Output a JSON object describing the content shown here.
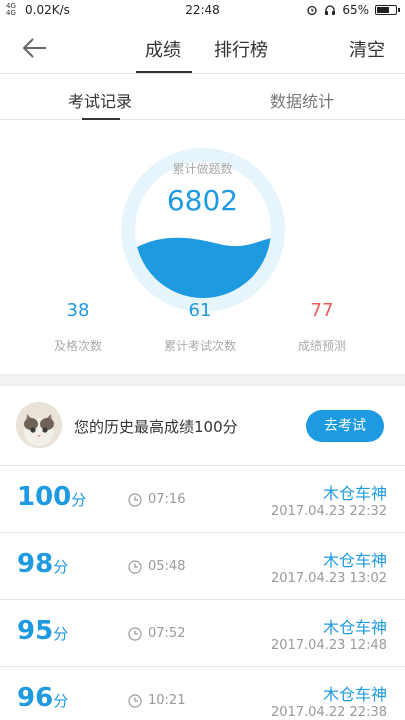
{
  "status_bar": {
    "network": "4G 4G",
    "speed": "0.02K/s",
    "time": "22:48",
    "battery": "65%"
  },
  "header": {
    "tabs": [
      "成绩",
      "排行榜"
    ],
    "active_tab": "成绩",
    "right_action": "清空"
  },
  "sub_tabs": {
    "tabs": [
      "考试记录",
      "数据统计"
    ],
    "active": "考试记录"
  },
  "summary": {
    "label": "累计做题数",
    "value": "6802",
    "accent": "#1e9be0"
  },
  "stats": [
    {
      "value": "38",
      "label": "及格次数",
      "color": "#1e9be0"
    },
    {
      "value": "61",
      "label": "累计考试次数",
      "color": "#1e9be0"
    },
    {
      "value": "77",
      "label": "成绩预测",
      "color": "#e85a5a"
    }
  ],
  "best": {
    "text": "您的历史最高成绩100分",
    "button": "去考试"
  },
  "records": [
    {
      "score": "100",
      "unit": "分",
      "duration": "07:16",
      "name": "木仓车神",
      "date": "2017.04.23  22:32"
    },
    {
      "score": "98",
      "unit": "分",
      "duration": "05:48",
      "name": "木仓车神",
      "date": "2017.04.23  13:02"
    },
    {
      "score": "95",
      "unit": "分",
      "duration": "07:52",
      "name": "木仓车神",
      "date": "2017.04.23  12:48"
    },
    {
      "score": "96",
      "unit": "分",
      "duration": "10:21",
      "name": "木仓车神",
      "date": "2017.04.22  22:38"
    }
  ]
}
